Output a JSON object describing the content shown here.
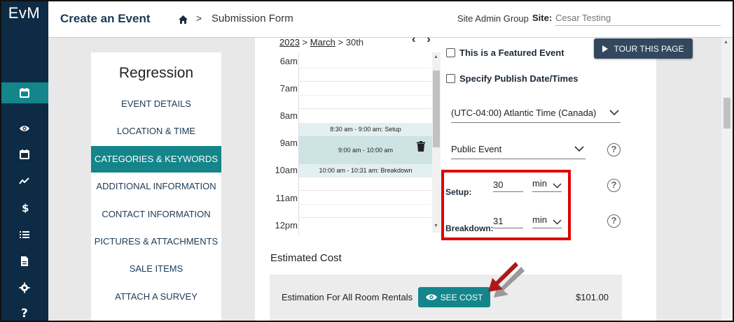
{
  "app": {
    "logo": "EvM"
  },
  "sidebar": {
    "icons": [
      "calendar-active-icon",
      "eye-icon",
      "calendar-icon",
      "trend-icon",
      "dollar-icon",
      "list-icon",
      "document-icon",
      "gear-icon",
      "help-icon"
    ]
  },
  "header": {
    "title": "Create an Event",
    "crumb_sep": ">",
    "crumb_page": "Submission Form",
    "site_group": "Site Admin Group",
    "site_label": "Site:",
    "site_placeholder": "Cesar Testing"
  },
  "nav": {
    "title": "Regression",
    "items": [
      {
        "label": "EVENT DETAILS",
        "active": false
      },
      {
        "label": "LOCATION & TIME",
        "active": false
      },
      {
        "label": "CATEGORIES & KEYWORDS",
        "active": true
      },
      {
        "label": "ADDITIONAL INFORMATION",
        "active": false
      },
      {
        "label": "CONTACT INFORMATION",
        "active": false
      },
      {
        "label": "PICTURES & ATTACHMENTS",
        "active": false
      },
      {
        "label": "SALE ITEMS",
        "active": false
      },
      {
        "label": "ATTACH A SURVEY",
        "active": false
      }
    ]
  },
  "calendar": {
    "year": "2023",
    "month": "March",
    "day": "30th",
    "sep": ">",
    "prev": "‹",
    "next": "›",
    "times": [
      "6am",
      "7am",
      "8am",
      "9am",
      "10am",
      "11am",
      "12pm"
    ],
    "events": [
      {
        "label": "8:30 am - 9:00 am: Setup"
      },
      {
        "label": "9:00 am - 10:00 am"
      },
      {
        "label": "10:00 am - 10:31 am: Breakdown"
      }
    ]
  },
  "form": {
    "featured_label": "This is a Featured Event",
    "publish_label": "Specify Publish Date/Times",
    "timezone": "(UTC-04:00) Atlantic Time (Canada)",
    "visibility": "Public Event",
    "setup_label": "Setup:",
    "setup_value": "30",
    "setup_unit": "min",
    "breakdown_label": "Breakdown:",
    "breakdown_value": "31",
    "breakdown_unit": "min",
    "help_glyph": "?"
  },
  "tour": {
    "label": "TOUR THIS PAGE"
  },
  "cost": {
    "title": "Estimated Cost",
    "row_label": "Estimation For All Room Rentals",
    "button_label": "SEE COST",
    "amount": "$101.00"
  },
  "colors": {
    "sidebar_bg": "#0d2b45",
    "accent": "#14858a",
    "highlight": "#e00000",
    "annotation_arrow": "#b01818"
  }
}
